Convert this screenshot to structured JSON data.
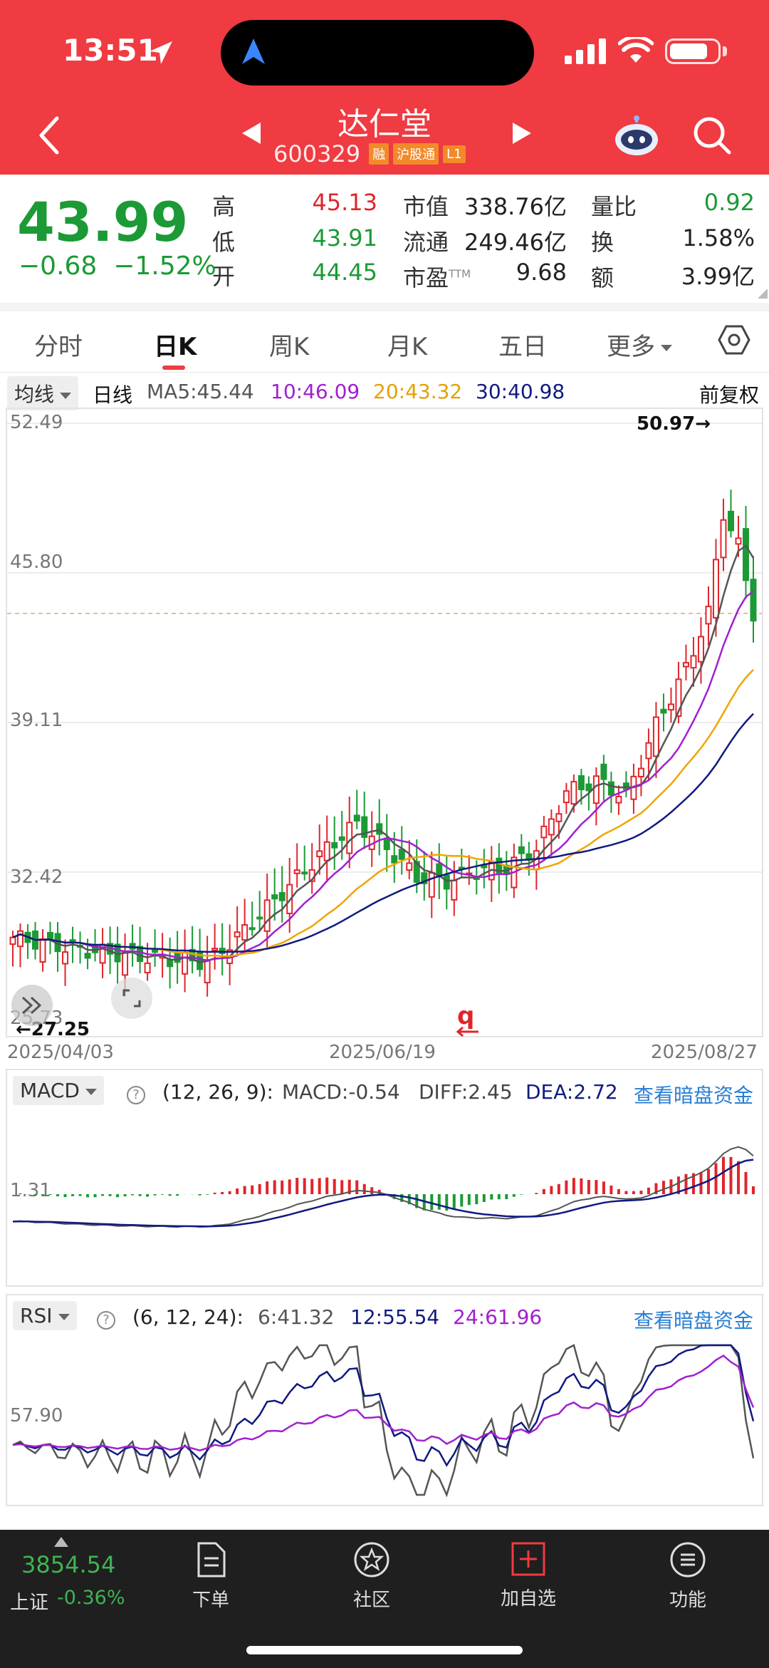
{
  "status": {
    "time": "13:51"
  },
  "header": {
    "name": "达仁堂",
    "code": "600329",
    "tags": [
      "融",
      "沪股通",
      "L1"
    ]
  },
  "quote": {
    "price": "43.99",
    "change": "−0.68",
    "change_pct": "−1.52%",
    "high_label": "高",
    "high": "45.13",
    "low_label": "低",
    "low": "43.91",
    "open_label": "开",
    "open": "44.45",
    "mcap_label": "市值",
    "mcap": "338.76亿",
    "float_label": "流通",
    "float": "249.46亿",
    "pe_label": "市盈",
    "pe_sup": "TTM",
    "pe": "9.68",
    "vr_label": "量比",
    "vr": "0.92",
    "turn_label": "换",
    "turn": "1.58%",
    "amt_label": "额",
    "amt": "3.99亿"
  },
  "tabs": [
    "分时",
    "日K",
    "周K",
    "月K",
    "五日",
    "更多"
  ],
  "ma": {
    "dropdown": "均线",
    "period": "日线",
    "ma5": "MA5:45.44",
    "ma10": "10:46.09",
    "ma20": "20:43.32",
    "ma30": "30:40.98",
    "adjust": "前复权"
  },
  "kline": {
    "y_labels": [
      "52.49",
      "45.80",
      "39.11",
      "32.42",
      "25.73"
    ],
    "max_note": "50.97→",
    "min_note": "←27.25",
    "dates": [
      "2025/04/03",
      "2025/06/19",
      "2025/08/27"
    ],
    "marker": "q"
  },
  "macd": {
    "dropdown": "MACD",
    "params": "(12, 26, 9):",
    "macd": "MACD:-0.54",
    "diff": "DIFF:2.45",
    "dea": "DEA:2.72",
    "link": "查看暗盘资金",
    "y_label": "1.31"
  },
  "rsi": {
    "dropdown": "RSI",
    "params": "(6, 12, 24):",
    "r6": "6:41.32",
    "r12": "12:55.54",
    "r24": "24:61.96",
    "link": "查看暗盘资金",
    "y_label": "57.90"
  },
  "bottom": {
    "index_value": "3854.54",
    "index_name": "上证",
    "index_change": "-0.36%",
    "nav": [
      "下单",
      "社区",
      "加自选",
      "功能"
    ]
  },
  "colors": {
    "brand_red": "#ef3b41",
    "up": "#e0252b",
    "down": "#1b9a35",
    "ma5": "#555555",
    "ma10": "#a020d0",
    "ma20": "#f0a500",
    "ma30": "#101a80"
  }
}
